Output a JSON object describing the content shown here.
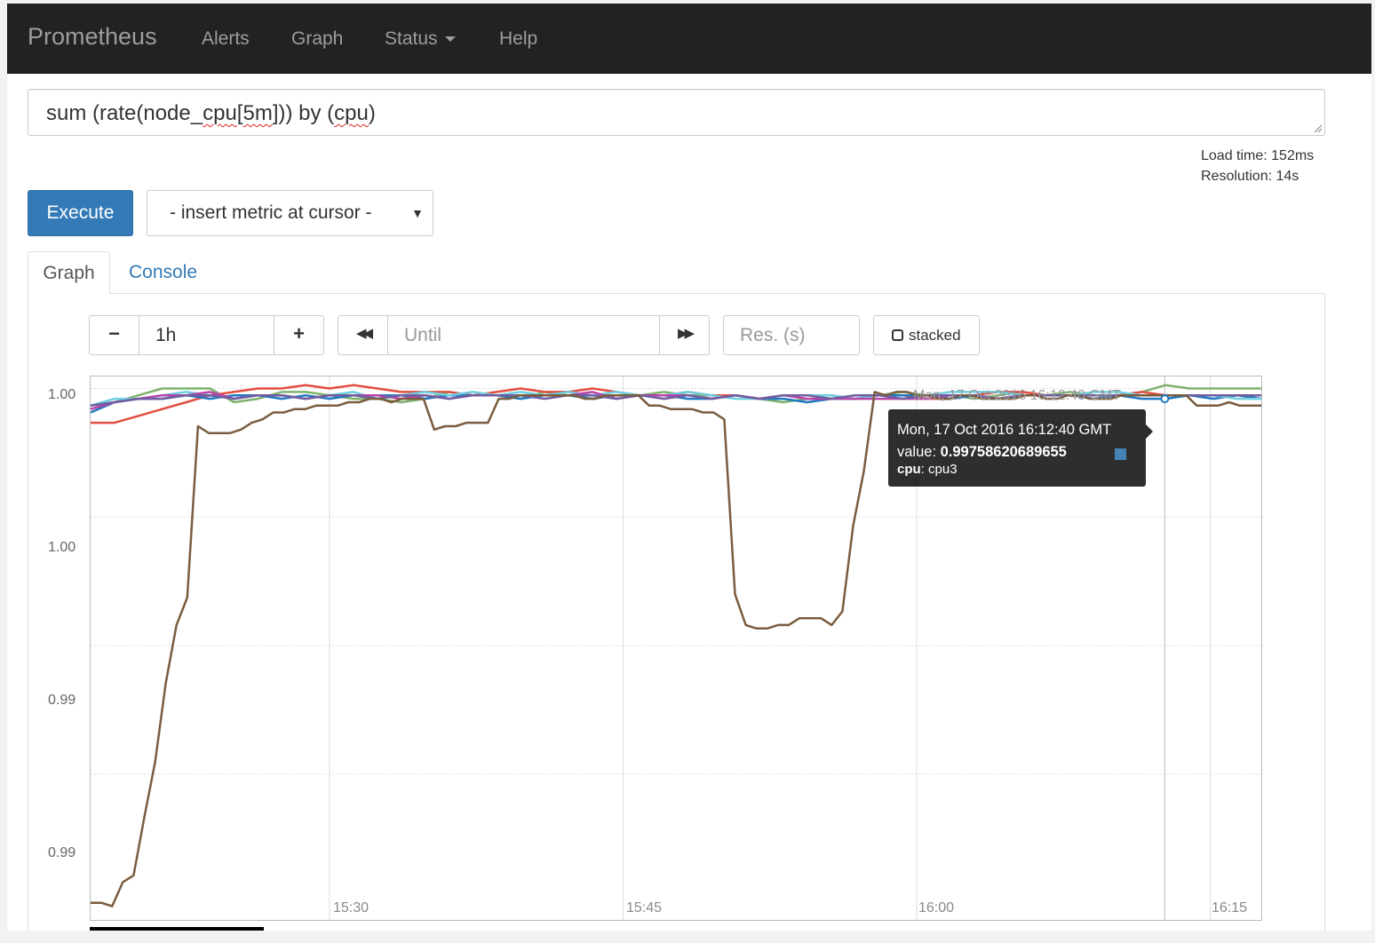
{
  "app": {
    "brand": "Prometheus",
    "nav": [
      {
        "label": "Alerts"
      },
      {
        "label": "Graph"
      },
      {
        "label": "Status"
      },
      {
        "label": "Help"
      }
    ]
  },
  "query": {
    "expr_parts": [
      "sum (rate(node_",
      "cpu",
      "[",
      "5m",
      "])) by (",
      "cpu",
      ")"
    ]
  },
  "stats": {
    "load_time": "Load time: 152ms",
    "resolution": "Resolution: 14s"
  },
  "toolbar": {
    "execute_label": "Execute",
    "insert_metric_label": "- insert metric at cursor -",
    "select_arrow": "▼"
  },
  "tabs": [
    {
      "label": "Graph",
      "active": true
    },
    {
      "label": "Console",
      "active": false
    }
  ],
  "graph_controls": {
    "minus": "−",
    "range": "1h",
    "plus": "+",
    "back": "◀◀",
    "until_placeholder": "Until",
    "forward": "▶▶",
    "res_placeholder": "Res. (s)",
    "stacked_label": "stacked"
  },
  "tooltip": {
    "header_time": "Mon, 17 Oct 2016 16:12:40 GMT",
    "time": "Mon, 17 Oct 2016 16:12:40 GMT",
    "value_label": "value:",
    "value": "0.99758620689655",
    "label_key": "cpu",
    "label_value": "cpu3",
    "swatch_color": "#4682b4"
  },
  "chart_data": {
    "type": "line",
    "ytick_labels": [
      "1.00",
      "1.00",
      "0.99",
      "0.99"
    ],
    "xtick_labels": [
      "15:30",
      "15:45",
      "16:00",
      "16:15"
    ],
    "x_ticks_minutes": [
      30,
      45,
      60,
      75
    ],
    "x_range_minutes": [
      17.8,
      77.6
    ],
    "y_range": [
      0.9845,
      1.00035
    ],
    "y_tick_values": [
      1.0,
      0.99625,
      0.9925,
      0.98875
    ],
    "series": [
      {
        "color": "#7eb26d",
        "values": [
          0.9995,
          0.9996,
          0.9998,
          1.0,
          1.0,
          1.0,
          0.9996,
          0.9997,
          0.9999,
          0.9999,
          0.9998,
          0.9997,
          0.9997,
          0.9996,
          0.9997,
          0.9999,
          0.9998,
          0.9998,
          0.9997,
          0.9999,
          0.9998,
          0.9997,
          0.9998,
          0.9998,
          0.9999,
          0.9998,
          0.9998,
          0.9998,
          0.9997,
          0.9996,
          0.9997,
          0.9997,
          0.9998,
          0.9998,
          0.9999,
          0.9998,
          0.9998,
          0.9997,
          0.9998,
          0.9999,
          0.9998,
          0.9999,
          0.9998,
          0.9998,
          0.9999,
          1.0001,
          1.0,
          1.0,
          1.0,
          1.0
        ]
      },
      {
        "color": "#e24d42",
        "values": [
          0.999,
          0.999,
          0.9992,
          0.9994,
          0.9996,
          0.9998,
          0.9999,
          1.0,
          1.0,
          1.0001,
          1.0,
          1.0001,
          1.0,
          0.9999,
          0.9999,
          0.9999,
          0.9998,
          0.9999,
          1.0,
          0.9999,
          0.9999,
          1.0,
          0.9999,
          0.9998,
          0.9998,
          0.9999,
          0.9998,
          0.9998,
          0.9997,
          0.9998,
          0.9998,
          0.9998,
          0.9997,
          0.9998,
          0.9998,
          0.9997,
          0.9997,
          0.9998,
          0.9999,
          0.9999,
          0.9998,
          0.9998,
          0.9998,
          0.9998,
          0.9999,
          0.9998,
          0.9998,
          0.9998,
          0.9998,
          0.9997
        ]
      },
      {
        "color": "#1f78c1",
        "values": [
          0.9993,
          0.9996,
          0.9997,
          0.9997,
          0.9998,
          0.9997,
          0.9998,
          0.9998,
          0.9997,
          0.9998,
          0.9997,
          0.9998,
          0.9998,
          0.9998,
          0.9997,
          0.9998,
          0.9998,
          0.9998,
          0.9997,
          0.9998,
          0.9998,
          0.9997,
          0.9998,
          0.9998,
          0.9998,
          0.9997,
          0.9997,
          0.9998,
          0.9997,
          0.9997,
          0.9996,
          0.9997,
          0.9997,
          0.9998,
          0.9998,
          0.9998,
          0.9997,
          0.9998,
          0.9997,
          0.9998,
          0.9998,
          0.9998,
          0.9997,
          0.9998,
          0.9997,
          0.9997,
          0.9998,
          0.9997,
          0.9998,
          0.9997
        ]
      },
      {
        "color": "#6ed0e0",
        "values": [
          0.9995,
          0.9997,
          0.9997,
          0.9998,
          0.9999,
          0.9998,
          0.9997,
          0.9998,
          0.9998,
          0.9997,
          0.9998,
          0.9999,
          0.9997,
          0.9998,
          0.9999,
          0.9998,
          0.9999,
          0.9998,
          0.9999,
          0.9998,
          0.9999,
          0.9998,
          0.9999,
          0.9998,
          0.9998,
          0.9999,
          0.9998,
          0.9997,
          0.9997,
          0.9998,
          0.9998,
          0.9998,
          0.9997,
          0.9998,
          0.9997,
          0.9998,
          0.9999,
          0.9999,
          0.9999,
          0.9998,
          0.9998,
          0.9998,
          0.9999,
          0.9999,
          0.9998,
          0.9998,
          0.9998,
          0.9998,
          0.9997,
          0.9997
        ]
      },
      {
        "color": "#ba43a9",
        "values": [
          0.9994,
          0.9996,
          0.9997,
          0.9998,
          0.9998,
          0.9999,
          0.9997,
          0.9998,
          0.9998,
          0.9997,
          0.9998,
          0.9998,
          0.9998,
          0.9997,
          0.9998,
          0.9997,
          0.9998,
          0.9998,
          0.9998,
          0.9998,
          0.9998,
          0.9999,
          0.9997,
          0.9998,
          0.9998,
          0.9998,
          0.9997,
          0.9998,
          0.9997,
          0.9998,
          0.9997,
          0.9997,
          0.9997,
          0.9997,
          0.9997,
          0.9997,
          0.9998,
          0.9998,
          0.9997,
          0.9998,
          0.9998,
          0.9998,
          0.9998,
          0.9998,
          0.9998,
          0.9998,
          0.9998,
          0.9998,
          0.9998,
          0.9998
        ]
      },
      {
        "color": "#705da0",
        "values": [
          0.9995,
          0.9996,
          0.9997,
          0.9997,
          0.9998,
          0.9998,
          0.9997,
          0.9998,
          0.9998,
          0.9997,
          0.9998,
          0.9998,
          0.9997,
          0.9998,
          0.9998,
          0.9997,
          0.9998,
          0.9998,
          0.9998,
          0.9997,
          0.9998,
          0.9998,
          0.9997,
          0.9998,
          0.9997,
          0.9998,
          0.9997,
          0.9998,
          0.9997,
          0.9998,
          0.9998,
          0.9997,
          0.9998,
          0.9998,
          0.9997,
          0.9998,
          0.9998,
          0.9998,
          0.9997,
          0.9998,
          0.9998,
          0.9998,
          0.9998,
          0.9998,
          0.9998,
          0.9998,
          0.9998,
          0.9998,
          0.9998,
          0.9998
        ]
      }
    ],
    "brown_series": {
      "color": "#7a5c3e",
      "values": [
        0.985,
        0.985,
        0.9849,
        0.9856,
        0.9858,
        0.9875,
        0.9891,
        0.9914,
        0.9931,
        0.9939,
        0.9989,
        0.9987,
        0.9987,
        0.9987,
        0.9988,
        0.999,
        0.9991,
        0.9993,
        0.9993,
        0.9994,
        0.9994,
        0.9995,
        0.9995,
        0.9995,
        0.9996,
        0.9996,
        0.9997,
        0.9997,
        0.9996,
        0.9997,
        0.9997,
        0.9997,
        0.9988,
        0.9989,
        0.9989,
        0.999,
        0.999,
        0.999,
        0.9997,
        0.9997,
        0.9998,
        0.9998,
        0.9998,
        0.9998,
        0.9998,
        0.9998,
        0.9997,
        0.9997,
        0.9998,
        0.9998,
        0.9998,
        0.9998,
        0.9995,
        0.9995,
        0.9994,
        0.9994,
        0.9994,
        0.9993,
        0.9993,
        0.9991,
        0.994,
        0.9931,
        0.993,
        0.993,
        0.9931,
        0.9931,
        0.9933,
        0.9933,
        0.9933,
        0.9931,
        0.9935,
        0.996,
        0.9976,
        0.9999,
        0.9998,
        0.9999,
        0.9999,
        0.9998,
        0.9998,
        0.9997,
        0.9997,
        0.9998,
        0.9998,
        0.9997,
        0.9997,
        0.9997,
        0.9997,
        0.9998,
        0.9998,
        0.9997,
        0.9997,
        0.9998,
        0.9998,
        0.9997,
        0.9997,
        0.9997,
        0.9998,
        0.9998,
        0.9998,
        0.9998,
        0.9998,
        0.9998,
        0.9998,
        0.9995,
        0.9995,
        0.9995,
        0.9996,
        0.9995,
        0.9995,
        0.9995
      ]
    },
    "hover_x_minutes": 72.67
  }
}
